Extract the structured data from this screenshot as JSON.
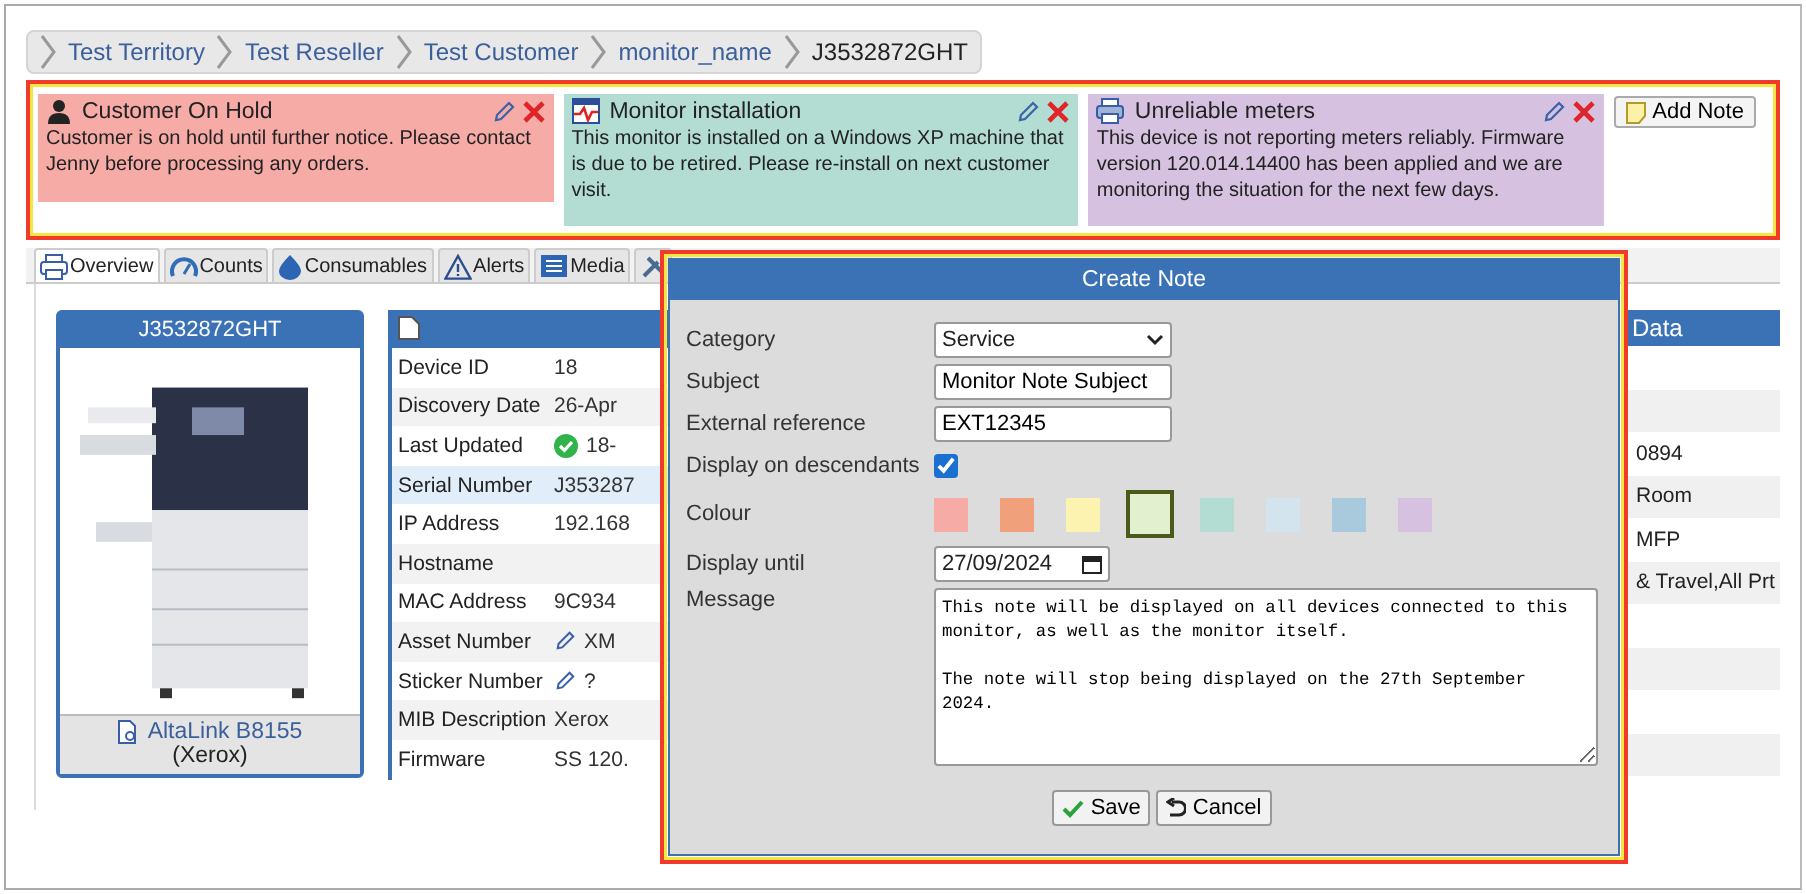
{
  "breadcrumb": [
    {
      "label": "Test Territory",
      "kind": "link"
    },
    {
      "label": "Test Reseller",
      "kind": "link"
    },
    {
      "label": "Test Customer",
      "kind": "link"
    },
    {
      "label": "monitor_name",
      "kind": "link"
    },
    {
      "label": "J3532872GHT",
      "kind": "current"
    }
  ],
  "notes": [
    {
      "kind": "customer",
      "title": "Customer On Hold",
      "text": "Customer is on hold until further notice. Please contact Jenny before processing any orders.",
      "color": "#f6aba6"
    },
    {
      "kind": "monitor",
      "title": "Monitor installation",
      "text": "This monitor is installed on a Windows XP machine that is due to be retired. Please re-install on next customer visit.",
      "color": "#b3ddd3"
    },
    {
      "kind": "device",
      "title": "Unreliable meters",
      "text": "This device is not reporting meters reliably. Firmware version 120.014.14400 has been applied and we are monitoring the situation for the next few days.",
      "color": "#d6c2e0"
    }
  ],
  "add_note_button": "Add Note",
  "tabs": [
    {
      "kind": "overview",
      "label": "Overview",
      "selected": true
    },
    {
      "kind": "counts",
      "label": "Counts",
      "selected": false
    },
    {
      "kind": "consumables",
      "label": "Consumables",
      "selected": false
    },
    {
      "kind": "alerts",
      "label": "Alerts",
      "selected": false
    },
    {
      "kind": "media",
      "label": "Media",
      "selected": false
    },
    {
      "kind": "tools",
      "selected": false
    }
  ],
  "device_card": {
    "title": "J3532872GHT",
    "model": "AltaLink B8155",
    "maker": "(Xerox)"
  },
  "details": [
    {
      "label": "Device ID",
      "value": "18",
      "kind": "plain",
      "selected": false
    },
    {
      "label": "Discovery Date",
      "value": "26-Apr",
      "kind": "plain",
      "selected": false
    },
    {
      "label": "Last Updated",
      "value": "18-",
      "kind": "status",
      "selected": false
    },
    {
      "label": "Serial Number",
      "value": "J353287",
      "kind": "plain",
      "selected": true
    },
    {
      "label": "IP Address",
      "value": "192.168",
      "kind": "plain",
      "selected": false
    },
    {
      "label": "Hostname",
      "kind": "plain",
      "selected": false
    },
    {
      "label": "MAC Address",
      "value": "9C934",
      "kind": "plain",
      "selected": false
    },
    {
      "label": "Asset Number",
      "value": "XM",
      "kind": "editable",
      "selected": false
    },
    {
      "label": "Sticker Number",
      "value": "?",
      "kind": "editable",
      "selected": false
    },
    {
      "label": "MIB Description",
      "value": "Xerox",
      "kind": "plain",
      "selected": false
    },
    {
      "label": "Firmware",
      "value": "SS 120.",
      "kind": "plain",
      "selected": false
    }
  ],
  "side_panel": {
    "title": "Data",
    "rows": [
      {
        "value": "0894"
      },
      {
        "value": "Room"
      },
      {
        "value": "MFP"
      },
      {
        "value": "& Travel,All Prt"
      }
    ]
  },
  "dialog": {
    "title": "Create Note",
    "fields": [
      {
        "kind": "select",
        "label": "Category",
        "value": "Service"
      },
      {
        "kind": "text",
        "label": "Subject",
        "value": "Monitor Note Subject"
      },
      {
        "kind": "text",
        "label": "External reference",
        "value": "EXT12345"
      },
      {
        "kind": "checkbox",
        "label": "Display on descendants",
        "checked": true
      },
      {
        "kind": "swatches",
        "label": "Colour",
        "swatches": [
          {
            "color": "#f6aba6",
            "selected": false
          },
          {
            "color": "#f0a07a",
            "selected": false
          },
          {
            "color": "#fdf3b0",
            "selected": false
          },
          {
            "color": "#e2f0d0",
            "selected": true
          },
          {
            "color": "#b3ddd3",
            "selected": false
          },
          {
            "color": "#d4e4ee",
            "selected": false
          },
          {
            "color": "#a9c9dd",
            "selected": false
          },
          {
            "color": "#d6c2e0",
            "selected": false
          }
        ]
      },
      {
        "kind": "date",
        "label": "Display until",
        "value": "27/09/2024"
      },
      {
        "kind": "textarea",
        "label": "Message",
        "value": "This note will be displayed on all devices connected to this\nmonitor, as well as the monitor itself.\n\nThe note will stop being displayed on the 27th September\n2024."
      }
    ],
    "buttons": [
      {
        "kind": "save",
        "label": "Save"
      },
      {
        "kind": "cancel",
        "label": "Cancel"
      }
    ]
  }
}
